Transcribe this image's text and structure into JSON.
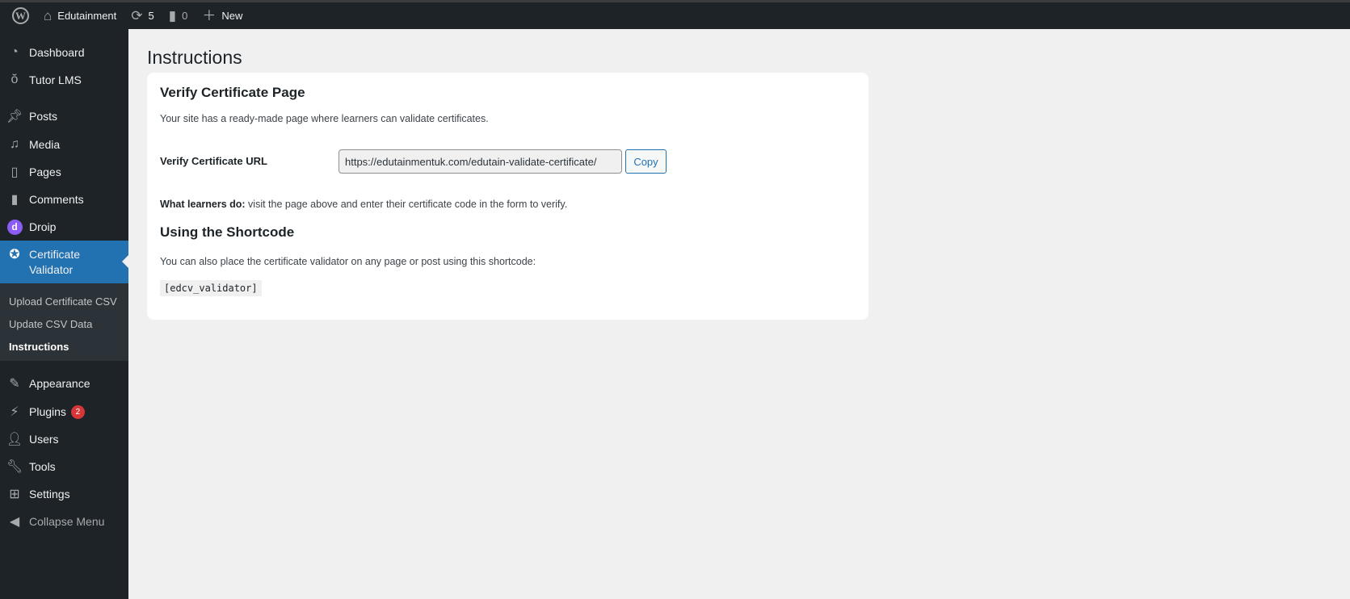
{
  "adminbar": {
    "site": "Edutainment",
    "updates": "5",
    "comments": "0",
    "new": "New"
  },
  "sidebar": {
    "items": [
      {
        "label": "Dashboard",
        "icon": "dashboard-icon"
      },
      {
        "label": "Tutor LMS",
        "icon": "tutor-icon"
      },
      {
        "label": "Posts",
        "icon": "pin-icon"
      },
      {
        "label": "Media",
        "icon": "media-icon"
      },
      {
        "label": "Pages",
        "icon": "pages-icon"
      },
      {
        "label": "Comments",
        "icon": "comment-icon"
      },
      {
        "label": "Droip",
        "icon": "droip-icon"
      },
      {
        "label": "Certificate Validator",
        "icon": "award-icon"
      },
      {
        "label": "Appearance",
        "icon": "brush-icon"
      },
      {
        "label": "Plugins",
        "icon": "plugin-icon",
        "badge": "2"
      },
      {
        "label": "Users",
        "icon": "user-icon"
      },
      {
        "label": "Tools",
        "icon": "wrench-icon"
      },
      {
        "label": "Settings",
        "icon": "settings-icon"
      },
      {
        "label": "Collapse Menu",
        "icon": "collapse-icon"
      }
    ],
    "submenu": [
      "Upload Certificate CSV",
      "Update CSV Data",
      "Instructions"
    ]
  },
  "page": {
    "title": "Instructions",
    "section1": {
      "heading": "Verify Certificate Page",
      "desc": "Your site has a ready-made page where learners can validate certificates.",
      "url_label": "Verify Certificate URL",
      "url_value": "https://edutainmentuk.com/edutain-validate-certificate/",
      "copy": "Copy",
      "learners_bold": "What learners do:",
      "learners_text": " visit the page above and enter their certificate code in the form to verify."
    },
    "section2": {
      "heading": "Using the Shortcode",
      "desc": "You can also place the certificate validator on any page or post using this shortcode:",
      "shortcode": "[edcv_validator]"
    }
  }
}
